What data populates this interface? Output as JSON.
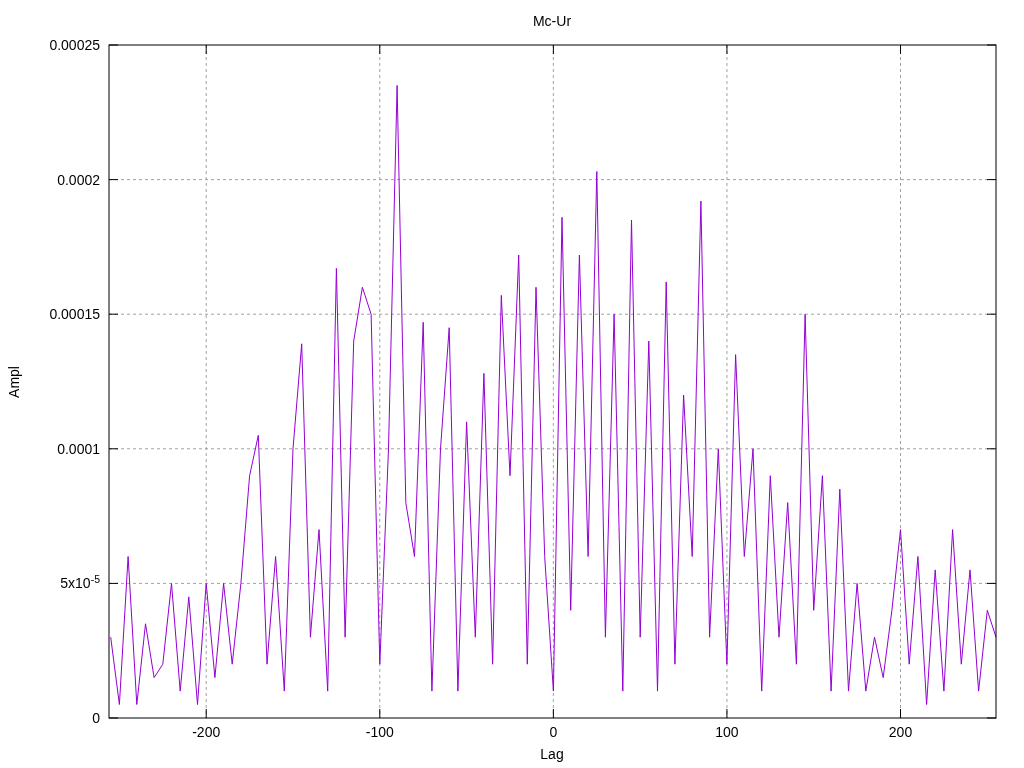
{
  "chart_data": {
    "type": "line",
    "title": "Mc-Ur",
    "xlabel": "Lag",
    "ylabel": "Ampl",
    "xlim": [
      -256,
      255
    ],
    "ylim": [
      0,
      0.00025
    ],
    "grid": true,
    "xticks": [
      {
        "value": -200,
        "label": "-200"
      },
      {
        "value": -100,
        "label": "-100"
      },
      {
        "value": 0,
        "label": "0"
      },
      {
        "value": 100,
        "label": "100"
      },
      {
        "value": 200,
        "label": "200"
      }
    ],
    "yticks": [
      {
        "value": 0,
        "label": "0"
      },
      {
        "value": 5e-05,
        "label": "5x10$^{-5}$"
      },
      {
        "value": 0.0001,
        "label": "0.0001"
      },
      {
        "value": 0.00015,
        "label": "0.00015"
      },
      {
        "value": 0.0002,
        "label": "0.0002"
      },
      {
        "value": 0.00025,
        "label": "0.00025"
      }
    ],
    "x": [
      -255,
      -250,
      -245,
      -240,
      -235,
      -230,
      -225,
      -220,
      -215,
      -210,
      -205,
      -200,
      -195,
      -190,
      -185,
      -180,
      -175,
      -170,
      -165,
      -160,
      -155,
      -150,
      -145,
      -140,
      -135,
      -130,
      -125,
      -120,
      -115,
      -110,
      -105,
      -100,
      -95,
      -90,
      -85,
      -80,
      -75,
      -70,
      -65,
      -60,
      -55,
      -50,
      -45,
      -40,
      -35,
      -30,
      -25,
      -20,
      -15,
      -10,
      -5,
      0,
      5,
      10,
      15,
      20,
      25,
      30,
      35,
      40,
      45,
      50,
      55,
      60,
      65,
      70,
      75,
      80,
      85,
      90,
      95,
      100,
      105,
      110,
      115,
      120,
      125,
      130,
      135,
      140,
      145,
      150,
      155,
      160,
      165,
      170,
      175,
      180,
      185,
      190,
      195,
      200,
      205,
      210,
      215,
      220,
      225,
      230,
      235,
      240,
      245,
      250,
      255
    ],
    "series": [
      {
        "color": "#9400d3",
        "values": [
          3e-05,
          5e-06,
          6e-05,
          5e-06,
          3.5e-05,
          1.5e-05,
          2e-05,
          5e-05,
          1e-05,
          4.5e-05,
          5e-06,
          5e-05,
          1.5e-05,
          5e-05,
          2e-05,
          5e-05,
          9e-05,
          0.000105,
          2e-05,
          6e-05,
          1e-05,
          0.0001,
          0.000139,
          3e-05,
          7e-05,
          1e-05,
          0.000167,
          3e-05,
          0.00014,
          0.00016,
          0.00015,
          2e-05,
          0.0001,
          0.000235,
          8e-05,
          6e-05,
          0.000147,
          1e-05,
          0.0001,
          0.000145,
          1e-05,
          0.00011,
          3e-05,
          0.000128,
          2e-05,
          0.000157,
          9e-05,
          0.000172,
          2e-05,
          0.00016,
          6e-05,
          1e-05,
          0.000186,
          4e-05,
          0.000172,
          6e-05,
          0.000203,
          3e-05,
          0.00015,
          1e-05,
          0.000185,
          3e-05,
          0.00014,
          1e-05,
          0.000162,
          2e-05,
          0.00012,
          6e-05,
          0.000192,
          3e-05,
          0.0001,
          2e-05,
          0.000135,
          6e-05,
          0.0001,
          1e-05,
          9e-05,
          3e-05,
          8e-05,
          2e-05,
          0.00015,
          4e-05,
          9e-05,
          1e-05,
          8.5e-05,
          1e-05,
          5e-05,
          1e-05,
          3e-05,
          1.5e-05,
          4e-05,
          7e-05,
          2e-05,
          6e-05,
          5e-06,
          5.5e-05,
          1e-05,
          7e-05,
          2e-05,
          5.5e-05,
          1e-05,
          4e-05,
          3e-05
        ]
      }
    ]
  }
}
